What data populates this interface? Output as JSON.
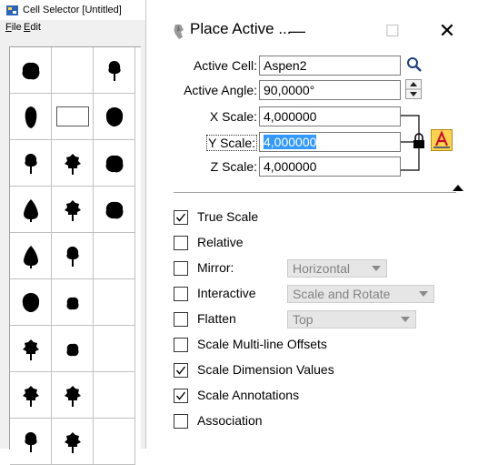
{
  "cell_selector": {
    "title": "Cell Selector [Untitled]",
    "menu": [
      "File",
      "Edit"
    ],
    "cells": [
      {
        "icon": "bush-round-icon"
      },
      {
        "icon": "empty"
      },
      {
        "icon": "tree-small-icon"
      },
      {
        "icon": "tree-oval-icon"
      },
      {
        "icon": "selected-empty"
      },
      {
        "icon": "tree-round-icon"
      },
      {
        "icon": "tree-small-icon"
      },
      {
        "icon": "tree-leafy-icon"
      },
      {
        "icon": "bush-round-icon"
      },
      {
        "icon": "tree-conifer-icon"
      },
      {
        "icon": "tree-leafy-icon"
      },
      {
        "icon": "bush-round-icon"
      },
      {
        "icon": "tree-conifer-icon"
      },
      {
        "icon": "tree-small-icon"
      },
      {
        "icon": "empty"
      },
      {
        "icon": "tree-round-icon"
      },
      {
        "icon": "bush-small-icon"
      },
      {
        "icon": "empty"
      },
      {
        "icon": "tree-leafy-icon"
      },
      {
        "icon": "bush-small-icon"
      },
      {
        "icon": "empty"
      },
      {
        "icon": "tree-leafy-icon"
      },
      {
        "icon": "tree-leafy-icon"
      },
      {
        "icon": "empty"
      },
      {
        "icon": "tree-small-icon"
      },
      {
        "icon": "tree-leafy-icon"
      },
      {
        "icon": "empty"
      }
    ]
  },
  "dialog": {
    "title": "Place Active ...",
    "minimize": "—",
    "maximize": "☐",
    "close": "✕",
    "fields": {
      "active_cell_label": "Active Cell:",
      "active_cell_value": "Aspen2",
      "active_angle_label": "Active Angle:",
      "active_angle_value": "90,0000°",
      "x_scale_label": "X Scale:",
      "x_scale_value": "4,000000",
      "y_scale_label": "Y Scale:",
      "y_scale_value": "4,000000",
      "z_scale_label": "Z Scale:",
      "z_scale_value": "4,000000"
    },
    "options": {
      "true_scale": {
        "label": "True Scale",
        "checked": true
      },
      "relative": {
        "label": "Relative",
        "checked": false
      },
      "mirror": {
        "label": "Mirror:",
        "checked": false,
        "combo": "Horizontal"
      },
      "interactive": {
        "label": "Interactive",
        "checked": false,
        "combo": "Scale and Rotate"
      },
      "flatten": {
        "label": "Flatten",
        "checked": false,
        "combo": "Top"
      },
      "scale_multiline": {
        "label": "Scale Multi-line Offsets",
        "checked": false
      },
      "scale_dimension": {
        "label": "Scale Dimension Values",
        "checked": true
      },
      "scale_annotations": {
        "label": "Scale Annotations",
        "checked": true
      },
      "association": {
        "label": "Association",
        "checked": false
      }
    }
  }
}
